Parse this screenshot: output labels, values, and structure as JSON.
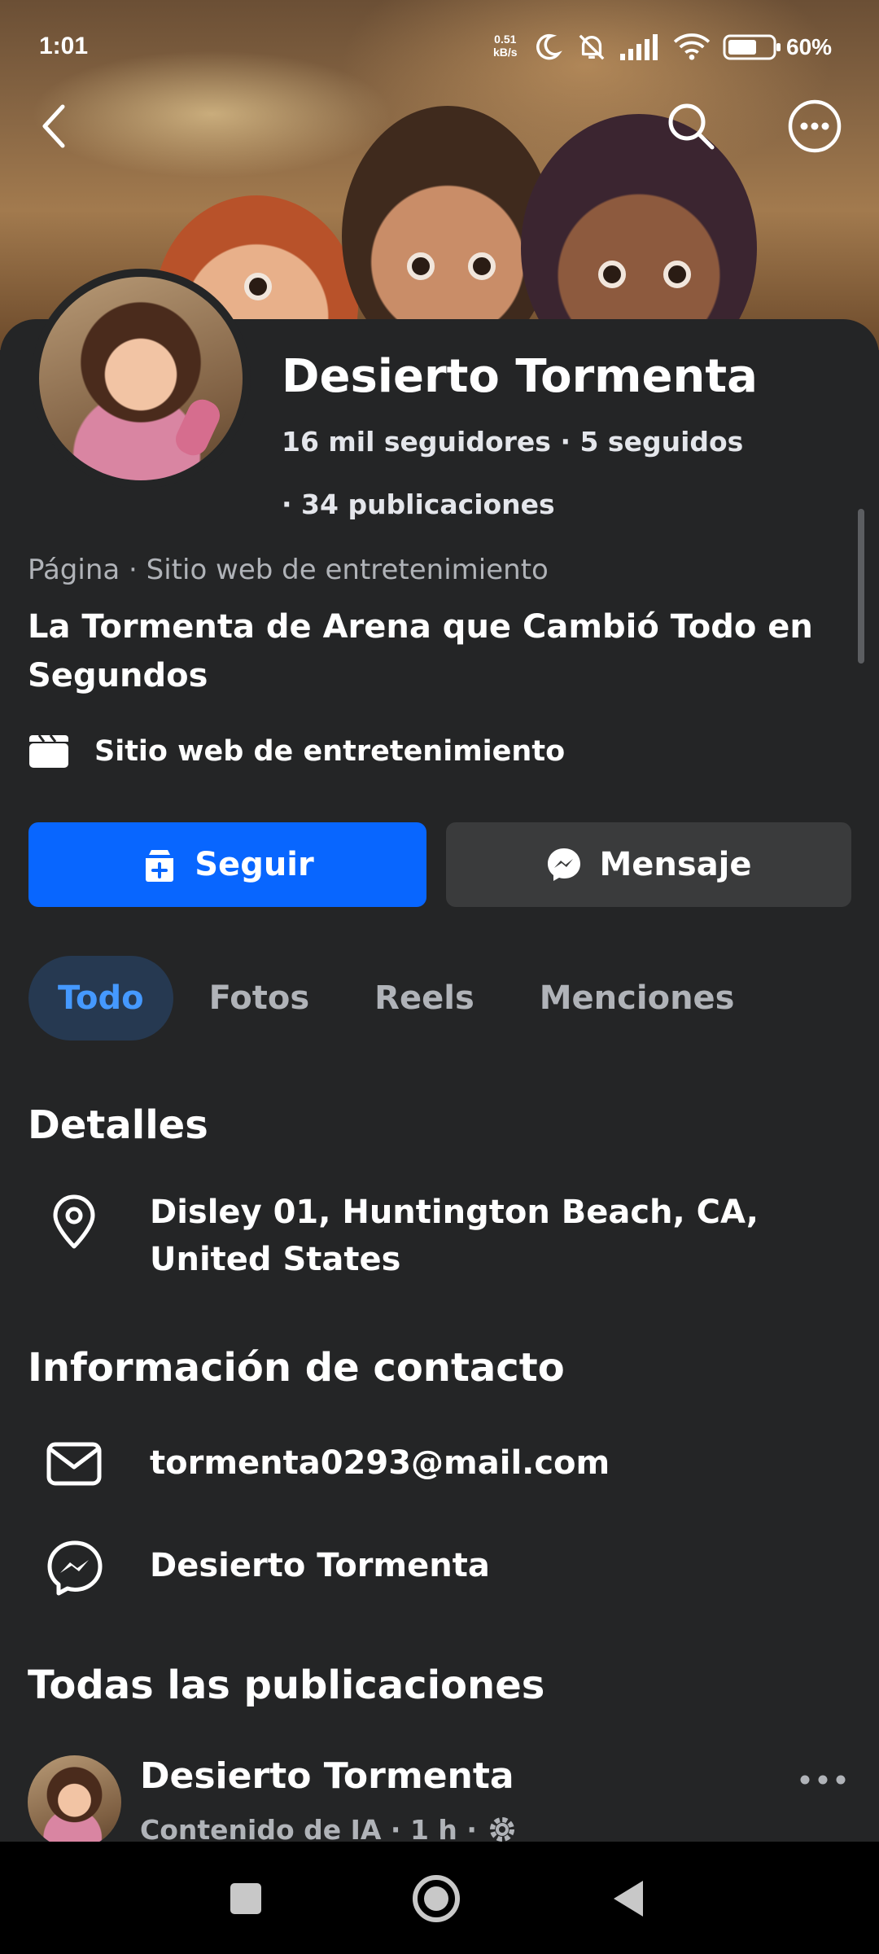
{
  "status_bar": {
    "time": "1:01",
    "net_speed_value": "0.51",
    "net_speed_unit": "kB/s",
    "battery_percent": "60%"
  },
  "profile": {
    "name": "Desierto Tormenta",
    "followers": "16 mil seguidores",
    "following": "5 seguidos",
    "posts": "34 publicaciones",
    "category_line": "Página · Sitio web de entretenimiento",
    "bio": "La Tormenta de Arena que Cambió Todo en Segundos",
    "site_category": "Sitio web de entretenimiento"
  },
  "actions": {
    "follow_label": "Seguir",
    "message_label": "Mensaje"
  },
  "tabs": [
    {
      "label": "Todo",
      "active": true
    },
    {
      "label": "Fotos",
      "active": false
    },
    {
      "label": "Reels",
      "active": false
    },
    {
      "label": "Menciones",
      "active": false
    }
  ],
  "details": {
    "title": "Detalles",
    "address": "Disley 01, Huntington Beach, CA, United States"
  },
  "contact": {
    "title": "Información de contacto",
    "email": "tormenta0293@mail.com",
    "messenger": "Desierto Tormenta"
  },
  "posts_section": {
    "title": "Todas las publicaciones",
    "first_post": {
      "author": "Desierto Tormenta",
      "meta": "Contenido de IA · 1 h ·"
    }
  },
  "icons": {
    "back": "arrow-left-icon",
    "search": "search-icon",
    "more": "more-horizontal-icon",
    "location": "map-pin-icon",
    "email": "envelope-icon",
    "messenger": "messenger-icon",
    "clapper": "clapperboard-icon",
    "privacy": "gear-icon"
  },
  "colors": {
    "accent": "#0866ff",
    "background": "#242526",
    "active_tab_bg": "#263951",
    "active_tab_text": "#4599ff"
  }
}
